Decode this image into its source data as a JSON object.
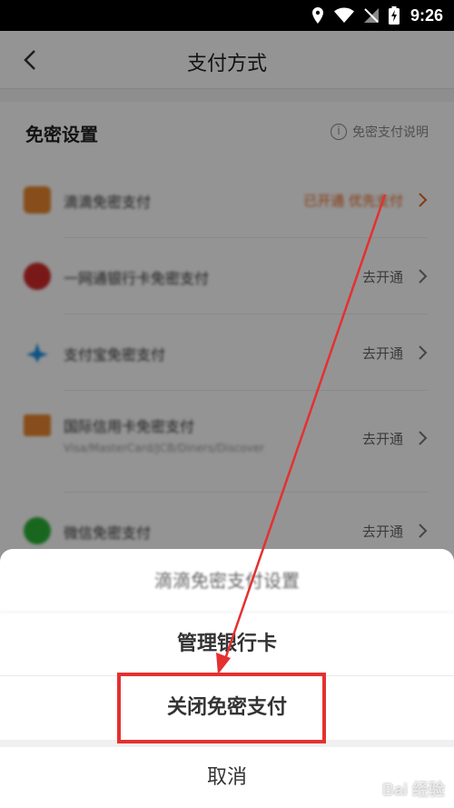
{
  "status_bar": {
    "time": "9:26"
  },
  "nav": {
    "title": "支付方式"
  },
  "section": {
    "title": "免密设置",
    "help": "免密支付说明",
    "rows": [
      {
        "label": "滴滴免密支付",
        "sub": "",
        "status": "已开通 优先支付",
        "icon": "didi-wallet-icon",
        "color": "#e8862e"
      },
      {
        "label": "一网通银行卡免密支付",
        "sub": "",
        "status": "去开通",
        "icon": "cmb-icon",
        "color": "#d02a2a"
      },
      {
        "label": "支付宝免密支付",
        "sub": "",
        "status": "去开通",
        "icon": "alipay-icon",
        "color": "#1b8fe3"
      },
      {
        "label": "国际信用卡免密支付",
        "sub": "Visa/MasterCard/JCB/Diners/Discover",
        "status": "去开通",
        "icon": "credit-card-icon",
        "color": "#e8862e"
      },
      {
        "label": "微信免密支付",
        "sub": "",
        "status": "去开通",
        "icon": "wechat-icon",
        "color": "#2bb235"
      }
    ]
  },
  "sheet": {
    "title": "滴滴免密支付设置",
    "option1": "管理银行卡",
    "option2": "关闭免密支付",
    "cancel": "取消"
  },
  "annotation": {
    "highlight_color": "#e53030"
  },
  "watermark": "Bai 经验"
}
